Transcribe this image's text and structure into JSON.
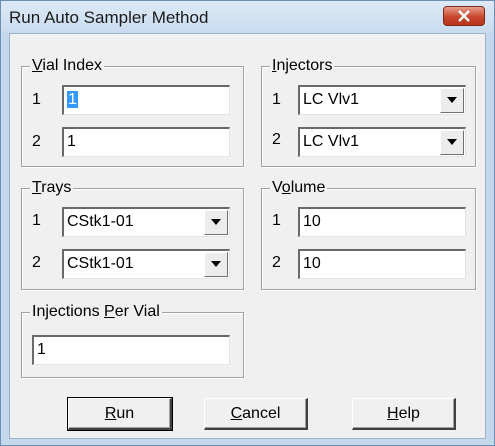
{
  "window": {
    "title": "Run Auto Sampler Method"
  },
  "vial_index": {
    "legend_mnemonic": "V",
    "legend_rest": "ial Index",
    "rows": [
      {
        "label": "1",
        "value": "1",
        "selected": true
      },
      {
        "label": "2",
        "value": "1"
      }
    ]
  },
  "injectors": {
    "legend_mnemonic": "I",
    "legend_rest": "njectors",
    "rows": [
      {
        "label": "1",
        "value": "LC Vlv1"
      },
      {
        "label": "2",
        "value": "LC Vlv1"
      }
    ]
  },
  "trays": {
    "legend_mnemonic": "T",
    "legend_rest": "rays",
    "rows": [
      {
        "label": "1",
        "value": "CStk1-01"
      },
      {
        "label": "2",
        "value": "CStk1-01"
      }
    ]
  },
  "volume": {
    "legend_pre": "V",
    "legend_mnemonic": "o",
    "legend_rest": "lume",
    "rows": [
      {
        "label": "1",
        "value": "10"
      },
      {
        "label": "2",
        "value": "10"
      }
    ]
  },
  "injections_per_vial": {
    "legend_pre": "Injections ",
    "legend_mnemonic": "P",
    "legend_rest": "er Vial",
    "value": "1"
  },
  "buttons": {
    "run": {
      "mnemonic": "R",
      "rest": "un"
    },
    "cancel": {
      "mnemonic": "C",
      "rest": "ancel"
    },
    "help": {
      "mnemonic": "H",
      "rest": "elp"
    }
  },
  "icons": {
    "close": "close-x-icon",
    "dropdown": "chevron-down-icon"
  },
  "colors": {
    "close_button": "#c7462c",
    "titlebar": "#c9dcef",
    "selection": "#3399ff"
  }
}
